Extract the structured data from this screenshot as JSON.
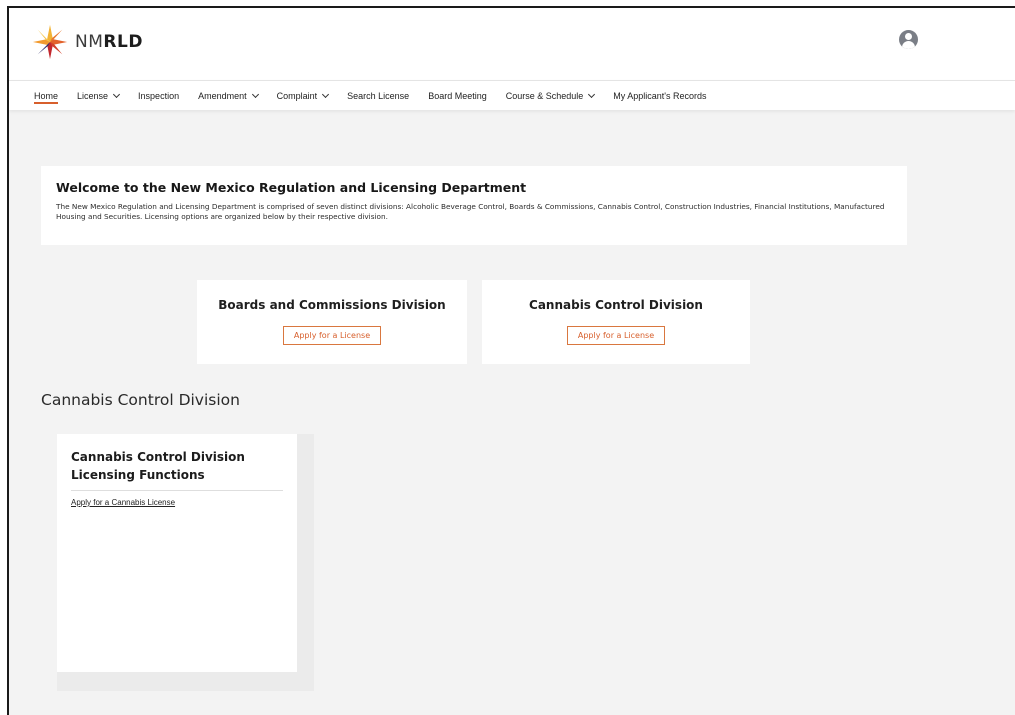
{
  "brand": {
    "logo_text_light": "NM",
    "logo_text_bold": "RLD",
    "logo_icon": "starburst-logo-icon",
    "accent_color": "#d75f2c"
  },
  "header": {
    "user_icon": "user-avatar-icon"
  },
  "nav": {
    "items": [
      {
        "label": "Home",
        "active": true,
        "has_dropdown": false
      },
      {
        "label": "License",
        "active": false,
        "has_dropdown": true
      },
      {
        "label": "Inspection",
        "active": false,
        "has_dropdown": false
      },
      {
        "label": "Amendment",
        "active": false,
        "has_dropdown": true
      },
      {
        "label": "Complaint",
        "active": false,
        "has_dropdown": true
      },
      {
        "label": "Search License",
        "active": false,
        "has_dropdown": false
      },
      {
        "label": "Board Meeting",
        "active": false,
        "has_dropdown": false
      },
      {
        "label": "Course & Schedule",
        "active": false,
        "has_dropdown": true
      },
      {
        "label": "My Applicant's Records",
        "active": false,
        "has_dropdown": false
      }
    ]
  },
  "welcome": {
    "title": "Welcome to the New Mexico Regulation and Licensing Department",
    "body": "The New Mexico Regulation and Licensing Department is comprised of seven distinct divisions: Alcoholic Beverage Control, Boards & Commissions, Cannabis Control, Construction Industries, Financial Institutions, Manufactured Housing and Securities. Licensing options are organized below by their respective division."
  },
  "divisions": [
    {
      "title": "Boards and Commissions Division",
      "button_label": "Apply for a License"
    },
    {
      "title": "Cannabis Control Division",
      "button_label": "Apply for a License"
    }
  ],
  "section": {
    "title": "Cannabis Control Division",
    "card_title": "Cannabis Control Division Licensing Functions",
    "link_label": "Apply for a Cannabis License"
  }
}
